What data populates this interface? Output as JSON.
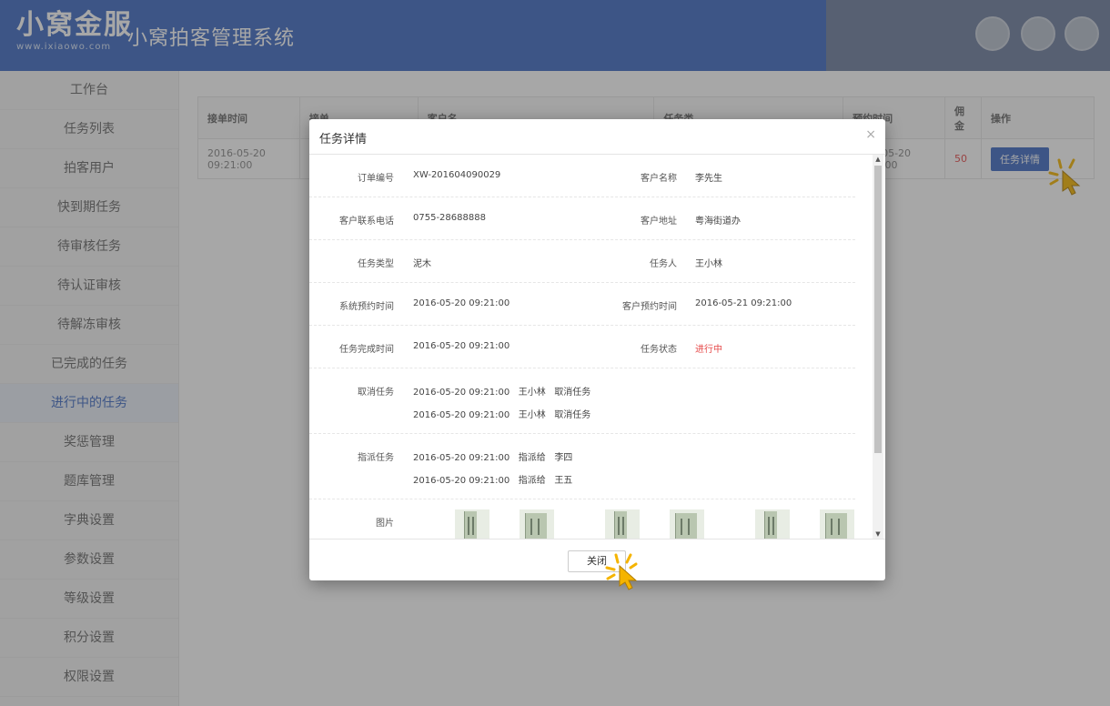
{
  "header": {
    "logo_text": "小窝金服",
    "logo_url": "www.ixiaowo.com",
    "system_title": "小窝拍客管理系统"
  },
  "sidebar": {
    "items": [
      {
        "label": "工作台"
      },
      {
        "label": "任务列表"
      },
      {
        "label": "拍客用户"
      },
      {
        "label": "快到期任务"
      },
      {
        "label": "待审核任务"
      },
      {
        "label": "待认证审核"
      },
      {
        "label": "待解冻审核"
      },
      {
        "label": "已完成的任务"
      },
      {
        "label": "进行中的任务"
      },
      {
        "label": "奖惩管理"
      },
      {
        "label": "题库管理"
      },
      {
        "label": "字典设置"
      },
      {
        "label": "参数设置"
      },
      {
        "label": "等级设置"
      },
      {
        "label": "积分设置"
      },
      {
        "label": "权限设置"
      }
    ]
  },
  "table": {
    "headers": [
      "接单时间",
      "接单",
      "客户名",
      "任务类",
      "预约时间",
      "佣金",
      "操作"
    ],
    "row": {
      "accept_date": "2016-05-20",
      "accept_time": "09:21:00",
      "appoint_date": "2016-05-20",
      "appoint_time": "09:21:00",
      "commission": "50",
      "action": "任务详情"
    }
  },
  "modal": {
    "title": "任务详情",
    "close_icon": "×",
    "fields": {
      "order_no_label": "订单编号",
      "order_no": "XW-201604090029",
      "customer_name_label": "客户名称",
      "customer_name": "李先生",
      "phone_label": "客户联系电话",
      "phone": "0755-28688888",
      "address_label": "客户地址",
      "address": "粤海街道办",
      "task_type_label": "任务类型",
      "task_type": "泥木",
      "assignee_label": "任务人",
      "assignee": "王小林",
      "sys_appoint_label": "系统预约时间",
      "sys_appoint": "2016-05-20 09:21:00",
      "cust_appoint_label": "客户预约时间",
      "cust_appoint": "2016-05-21 09:21:00",
      "finish_label": "任务完成时间",
      "finish": "2016-05-20 09:21:00",
      "status_label": "任务状态",
      "status": "进行中",
      "cancel_label": "取消任务",
      "cancel_entries": [
        {
          "time": "2016-05-20 09:21:00",
          "who": "王小林",
          "action": "取消任务"
        },
        {
          "time": "2016-05-20 09:21:00",
          "who": "王小林",
          "action": "取消任务"
        }
      ],
      "assign_label": "指派任务",
      "assign_entries": [
        {
          "time": "2016-05-20 09:21:00",
          "action": "指派给",
          "to": "李四"
        },
        {
          "time": "2016-05-20 09:21:00",
          "action": "指派给",
          "to": "王五"
        }
      ],
      "photos_label": "图片"
    },
    "close_button": "关闭"
  },
  "colors": {
    "brand": "#3e6bc3",
    "status_red": "#e64a4a",
    "cursor_yellow": "#f5b400"
  }
}
